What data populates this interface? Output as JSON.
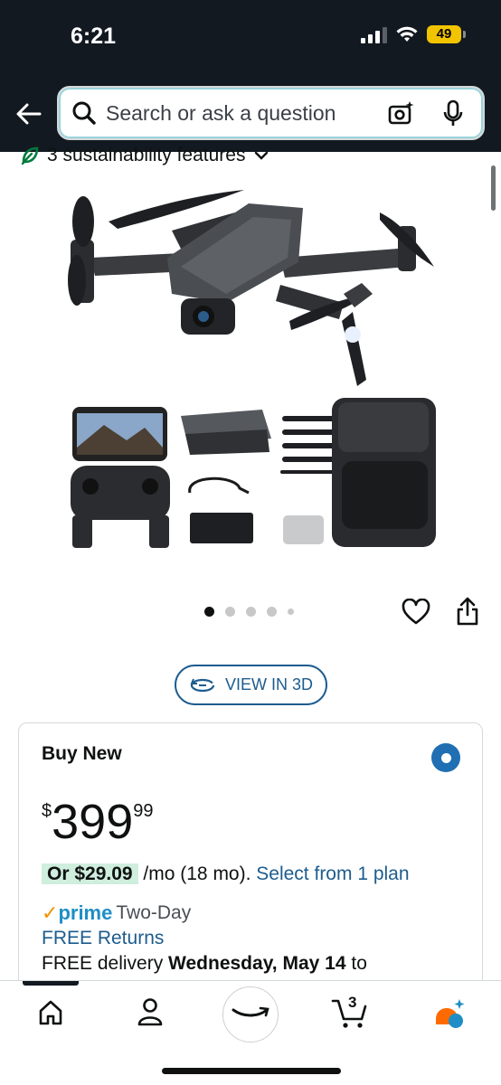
{
  "status_bar": {
    "time": "6:21",
    "battery": "49"
  },
  "search": {
    "placeholder": "Search or ask a question"
  },
  "sustainability": {
    "text": "3 sustainability features"
  },
  "gallery": {
    "dots": 5,
    "active_index": 0
  },
  "view_in_3d": {
    "label": "VIEW IN 3D"
  },
  "buy_box": {
    "title": "Buy New",
    "price_symbol": "$",
    "price_whole": "399",
    "price_fraction": "99",
    "monthly_prefix": "Or $29.09",
    "monthly_suffix": " /mo (18 mo). ",
    "monthly_link": "Select from 1 plan",
    "prime_check": "✓",
    "prime_word": "prime",
    "prime_rest": "Two-Day",
    "free_returns": "FREE Returns",
    "delivery_prefix": "FREE delivery ",
    "delivery_date": "Wednesday, May 14",
    "delivery_suffix": " to"
  },
  "tabbar": {
    "cart_count": "3"
  },
  "colors": {
    "header_bg": "#131921",
    "link": "#1d5c8f",
    "prime_blue": "#1f8ec6",
    "radio_selected": "#1f6fb2",
    "battery": "#f2c400"
  },
  "icons": [
    "back-arrow-icon",
    "search-icon",
    "camera-icon",
    "mic-icon",
    "leaf-icon",
    "chevron-down-icon",
    "heart-icon",
    "share-icon",
    "rotate-3d-icon",
    "home-icon",
    "account-icon",
    "amazon-smile-icon",
    "cart-icon",
    "rufus-icon"
  ]
}
